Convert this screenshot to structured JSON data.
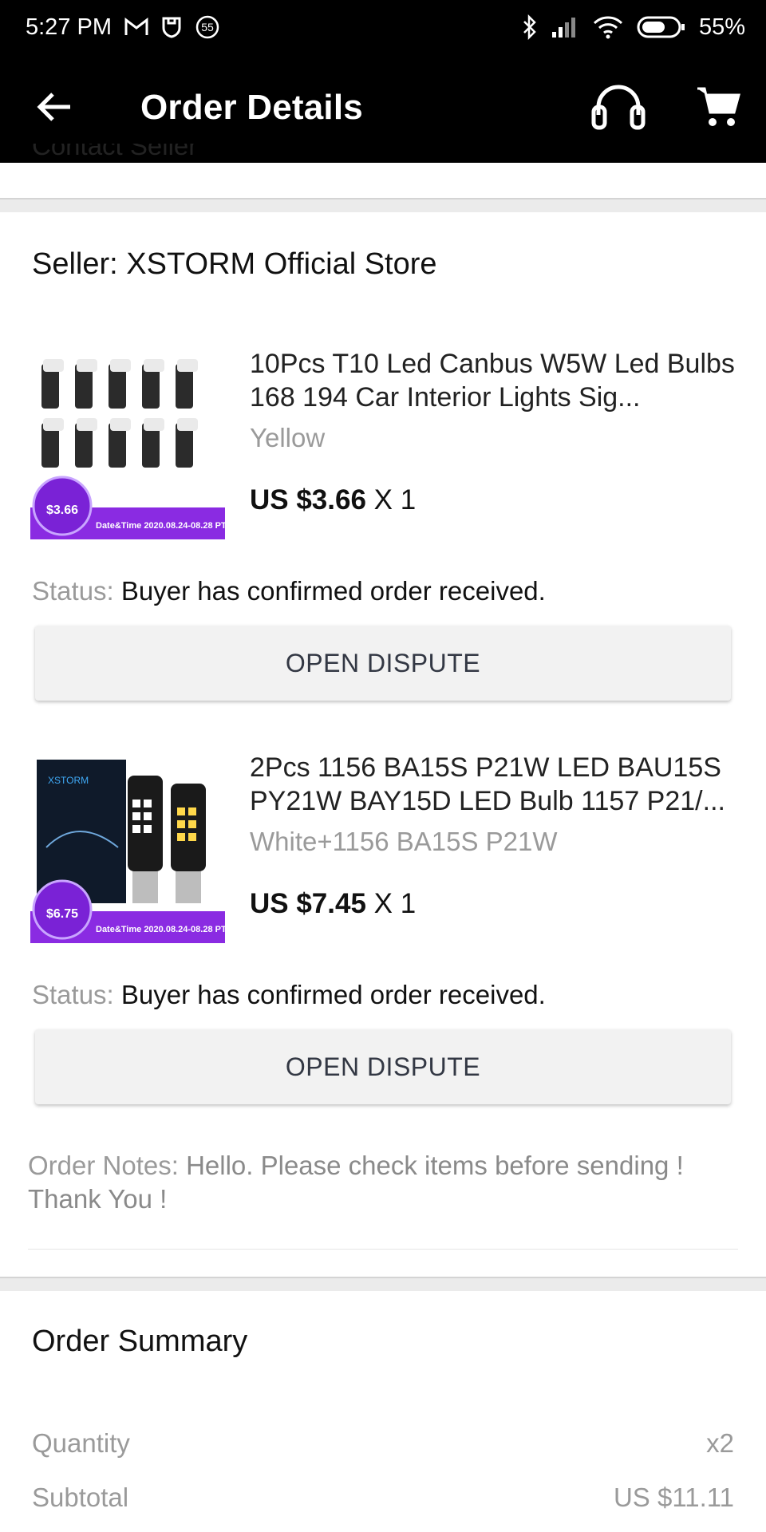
{
  "status_bar": {
    "time": "5:27 PM",
    "notif_badge": "55",
    "battery_pct": "55%",
    "icons": [
      "gmail-icon",
      "mi-shield-icon",
      "notification-55-icon",
      "bluetooth-icon",
      "signal-icon",
      "wifi-icon",
      "battery-icon"
    ]
  },
  "app_bar": {
    "title": "Order Details",
    "icons": [
      "back-arrow-icon",
      "headset-icon",
      "cart-icon"
    ]
  },
  "contact_seller": "Contact Seller",
  "seller": {
    "label": "Seller: XSTORM Official Store"
  },
  "items": [
    {
      "title": "10Pcs T10 Led Canbus W5W Led Bulbs 168 194 Car Interior Lights Sig...",
      "variant": "Yellow",
      "price": "US $3.66",
      "qty": "X 1",
      "status_label": "Status:",
      "status_value": "Buyer has confirmed order received.",
      "dispute_label": "OPEN DISPUTE",
      "badge_price": "$3.66",
      "badge_text": "Date&Time 2020.08.24-08.28 PT"
    },
    {
      "title": "2Pcs 1156 BA15S P21W LED BAU15S PY21W BAY15D LED Bulb 1157 P21/...",
      "variant": "White+1156 BA15S P21W",
      "price": "US $7.45",
      "qty": "X 1",
      "status_label": "Status:",
      "status_value": "Buyer has confirmed order received.",
      "dispute_label": "OPEN DISPUTE",
      "badge_price": "$6.75",
      "badge_text": "Date&Time 2020.08.24-08.28 PT"
    }
  ],
  "order_notes": {
    "label": "Order Notes:",
    "text": "Hello. Please check items before sending ! Thank You !"
  },
  "summary": {
    "title": "Order Summary",
    "rows": [
      {
        "label": "Quantity",
        "value": "x2"
      },
      {
        "label": "Subtotal",
        "value": "US $11.11"
      }
    ]
  },
  "colors": {
    "bar_bg": "#000000",
    "promo_purple": "#8a2be2",
    "muted_text": "#9a9a9a",
    "button_bg": "#f2f2f2"
  }
}
